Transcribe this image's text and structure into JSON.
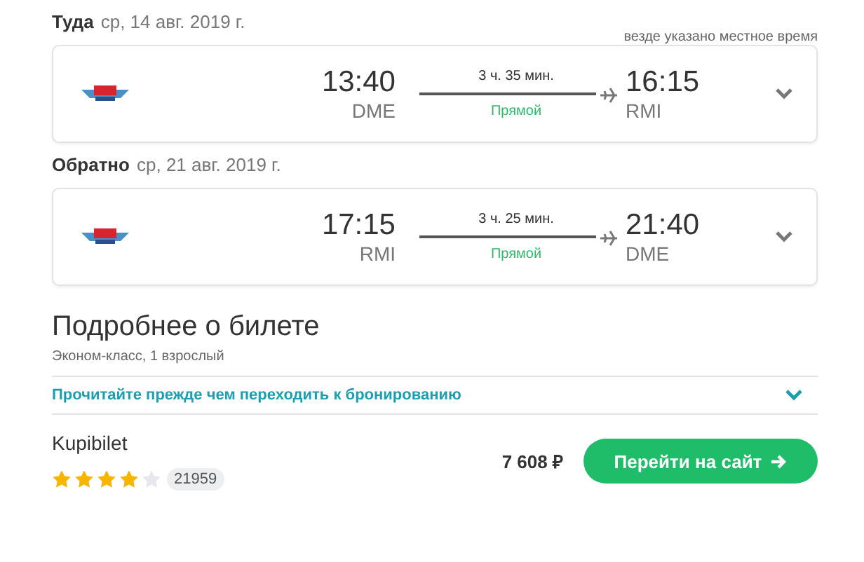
{
  "timezone_note": "везде указано местное время",
  "legs": [
    {
      "direction": "Туда",
      "date": "ср, 14 авг. 2019 г.",
      "depart_time": "13:40",
      "depart_airport": "DME",
      "duration": "3 ч. 35 мин.",
      "stops": "Прямой",
      "arrive_time": "16:15",
      "arrive_airport": "RMI",
      "expanded": false
    },
    {
      "direction": "Обратно",
      "date": "ср, 21 авг. 2019 г.",
      "depart_time": "17:15",
      "depart_airport": "RMI",
      "duration": "3 ч. 25 мин.",
      "stops": "Прямой",
      "arrive_time": "21:40",
      "arrive_airport": "DME",
      "expanded": false
    }
  ],
  "ticket": {
    "title": "Подробнее о билете",
    "subtitle": "Эконом-класс, 1 взрослый",
    "notice": "Прочитайте прежде чем переходить к бронированию",
    "notice_expanded": false
  },
  "offer": {
    "agency": "Kupibilet",
    "stars": 4,
    "reviews": "21959",
    "price": "7 608 ₽",
    "button": "Перейти на сайт"
  }
}
